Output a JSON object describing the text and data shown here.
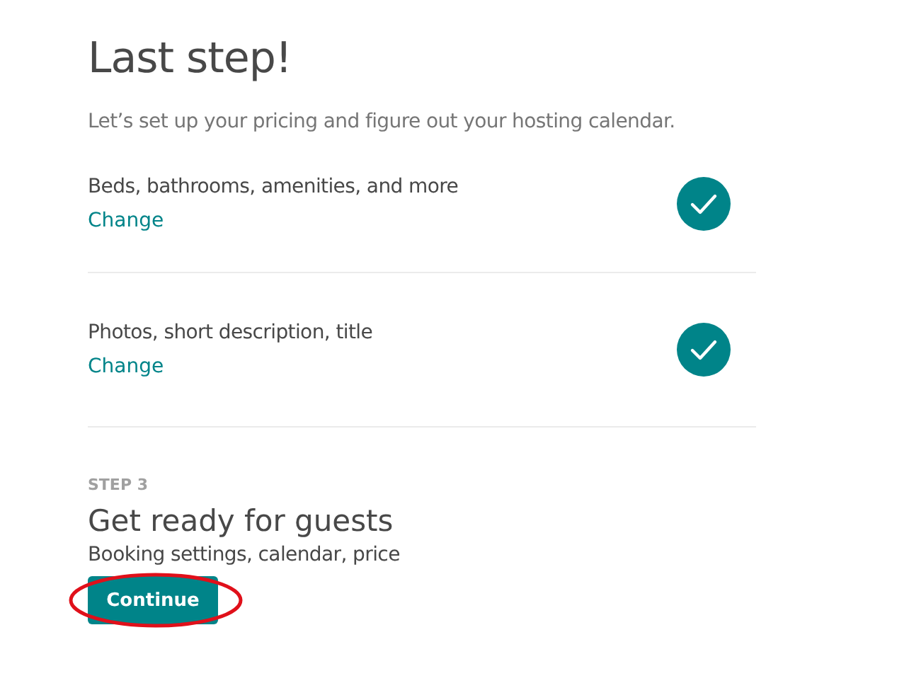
{
  "title": "Last step!",
  "subtitle": "Let’s set up your pricing and figure out your hosting calendar.",
  "steps": [
    {
      "label": "Beds, bathrooms, amenities, and more",
      "link": "Change",
      "completed": true
    },
    {
      "label": "Photos, short description, title",
      "link": "Change",
      "completed": true
    }
  ],
  "current_step": {
    "eyebrow": "STEP 3",
    "heading": "Get ready for guests",
    "description": "Booking settings, calendar, price",
    "button": "Continue"
  }
}
